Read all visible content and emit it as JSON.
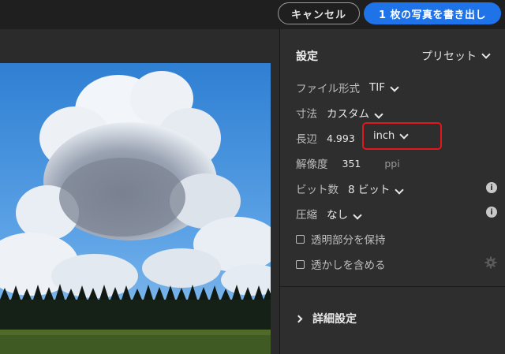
{
  "header": {
    "cancel_label": "キャンセル",
    "export_label": "1 枚の写真を書き出し"
  },
  "settings": {
    "title": "設定",
    "preset_label": "プリセット",
    "file_format": {
      "label": "ファイル形式",
      "value": "TIF"
    },
    "dimensions": {
      "label": "寸法",
      "value": "カスタム"
    },
    "long_edge": {
      "label": "長辺",
      "value": "4.993",
      "unit": "inch"
    },
    "resolution": {
      "label": "解像度",
      "value": "351",
      "unit": "ppi"
    },
    "bit_depth": {
      "label": "ビット数",
      "value": "8 ビット"
    },
    "compression": {
      "label": "圧縮",
      "value": "なし"
    },
    "preserve_transparency": {
      "label": "透明部分を保持",
      "checked": false
    },
    "watermark": {
      "label": "透かしを含める",
      "checked": false
    },
    "advanced_label": "詳細設定"
  },
  "colors": {
    "accent": "#1f73e8",
    "highlight_border": "#e3161b",
    "panel_bg": "#2e2e2e"
  }
}
